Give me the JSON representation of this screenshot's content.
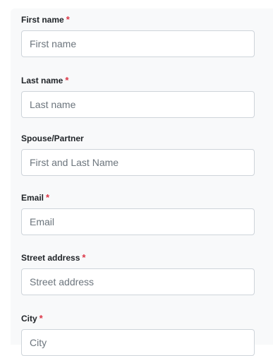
{
  "colors": {
    "required_marker": "#dc3545",
    "panel_background": "#f8f9fa",
    "input_border": "#ced4da",
    "placeholder_text": "#6c757d"
  },
  "form": {
    "fields": [
      {
        "label": "First name",
        "required_marker": "*",
        "placeholder": "First name",
        "value": ""
      },
      {
        "label": "Last name",
        "required_marker": "*",
        "placeholder": "Last name",
        "value": ""
      },
      {
        "label": "Spouse/Partner",
        "required_marker": "",
        "placeholder": "First and Last Name",
        "value": ""
      },
      {
        "label": "Email",
        "required_marker": "*",
        "placeholder": "Email",
        "value": ""
      },
      {
        "label": "Street address",
        "required_marker": "*",
        "placeholder": "Street address",
        "value": ""
      },
      {
        "label": "City",
        "required_marker": "*",
        "placeholder": "City",
        "value": ""
      }
    ]
  }
}
